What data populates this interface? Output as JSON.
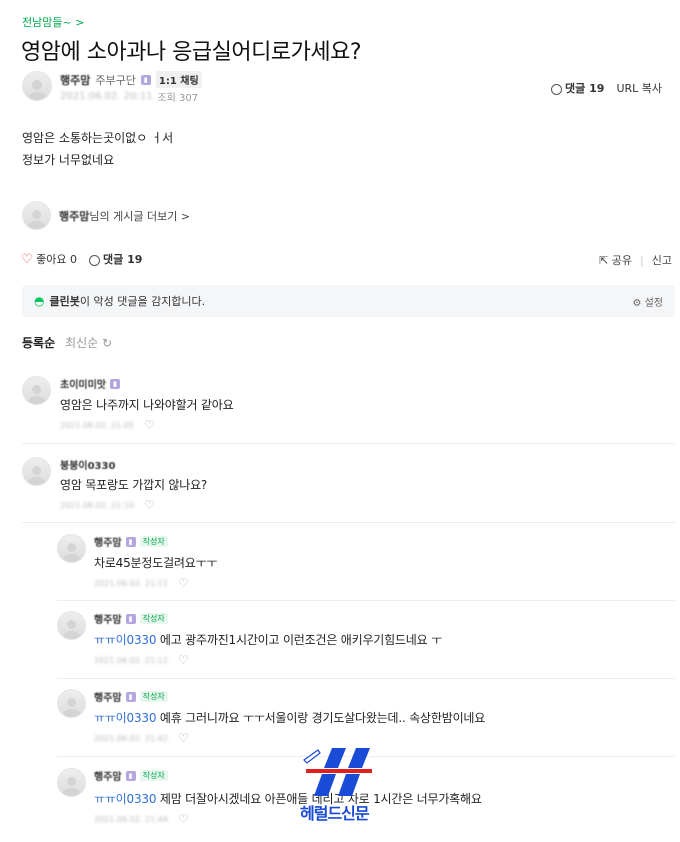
{
  "header": {
    "cafe_link": "전남맘들~ >",
    "title": "영암에 소아과나 응급실어디로가세요?"
  },
  "post": {
    "author": "행주맘",
    "grade": "주부구단",
    "chat_tag": "1:1 채팅",
    "views": "조회 307",
    "date": "2021.06.02. 20:11",
    "comment_count_label": "댓글 19",
    "url_copy": "URL 복사",
    "body_lines": [
      "영암은 소통하는곳이없ㅇ ㅓ서",
      "정보가 너무없네요"
    ],
    "more_posts_author": "행주맘",
    "more_posts_suffix": "님의 게시글 더보기 >",
    "like_label": "좋아요 0",
    "comment_label": "댓글 19",
    "share_label": "공유",
    "report_label": "신고"
  },
  "cleanbot": {
    "name": "클린봇",
    "message": "이 악성 댓글을 감지합니다.",
    "settings": "설정"
  },
  "sort": {
    "active": "등록순",
    "inactive": "최신순"
  },
  "comments": [
    {
      "author": "초이미미맛",
      "text": "영암은 나주까지 나와야할거 같아요",
      "date": "2021.06.02. 21:05"
    },
    {
      "author": "붕붕이0330",
      "text": "영암 목포랑도 가깝지 않나요?",
      "date": "2021.06.02. 21:10"
    }
  ],
  "replies": [
    {
      "author": "행주맘",
      "tag": "작성자",
      "mention": "",
      "text": "차로45분정도걸려요ㅜㅜ",
      "date": "2021.06.02. 21:11"
    },
    {
      "author": "행주맘",
      "tag": "작성자",
      "mention": "ㅠㅠ이0330",
      "text": "에고 광주까진1시간이고 이런조건은 애키우기힘드네요 ㅜ",
      "date": "2021.06.02. 21:12"
    },
    {
      "author": "행주맘",
      "tag": "작성자",
      "mention": "ㅠㅠ이0330",
      "text": "예휴 그러니까요 ㅜㅜ서울이랑 경기도살다왔는데.. 속상한밤이네요",
      "date": "2021.06.02. 21:42"
    },
    {
      "author": "행주맘",
      "tag": "작성자",
      "mention": "ㅠㅠ이0330",
      "text": "제맘 더잘아시겠네요 아픈애들 데리고 차로 1시간은 너무가혹해요",
      "date": "2021.06.02. 21:44"
    }
  ],
  "watermark": "헤럴드신문",
  "colors": {
    "accent_green": "#03a94f",
    "mention_blue": "#2f6fd8",
    "heart_red": "#e34b4b"
  }
}
